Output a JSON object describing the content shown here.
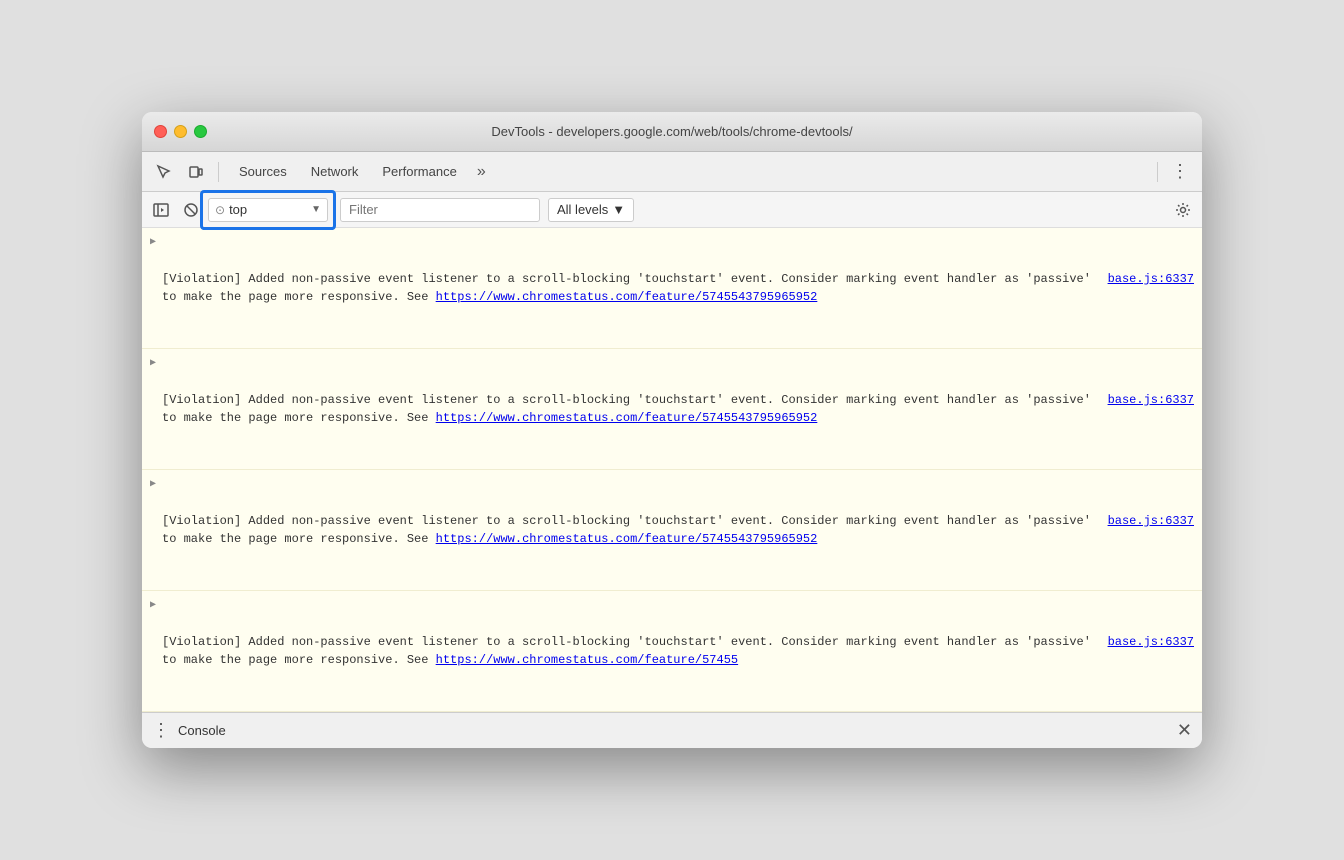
{
  "window": {
    "title": "DevTools - developers.google.com/web/tools/chrome-devtools/"
  },
  "toolbar": {
    "tabs": [
      "Sources",
      "Network",
      "Performance"
    ],
    "more_label": "»",
    "kebab_label": "⋮"
  },
  "console_toolbar": {
    "context_value": "top",
    "filter_placeholder": "Filter",
    "levels_label": "All levels",
    "levels_arrow": "▼"
  },
  "console_entries": [
    {
      "message_start": "[Violation] Added non-passive event listener to a scroll-blocking 'touchstart' event. Consider marking event handler as 'passive' to make the page more responsive. See ",
      "link_text": "https://www.chromestatus.com/feature/5745543795965952",
      "source": "base.js:6337",
      "partial": false
    },
    {
      "message_start": "[Violation] Added non-passive event listener to a scroll-blocking 'touchstart' event. Consider marking event handler as 'passive' to make the page more responsive. See ",
      "link_text": "https://www.chromestatus.com/feature/5745543795965952",
      "source": "base.js:6337",
      "partial": false
    },
    {
      "message_start": "[Violation] Added non-passive event listener to a scroll-blocking 'touchstart' event. Consider marking event handler as 'passive' to make the page more responsive. See ",
      "link_text": "https://www.chromestatus.com/feature/5745543795965952",
      "source": "base.js:6337",
      "partial": false
    },
    {
      "message_start": "[Violation] Added non-passive event listener to a scroll-blocking 'touchstart' event. Consider marking event handler as 'passive' to make the page more responsive. See ",
      "link_text": "https://www.chromestatus.com/feature/57455",
      "source": "base.js:6337",
      "partial": true
    }
  ],
  "bottom_bar": {
    "title": "Console",
    "close_label": "✕"
  }
}
